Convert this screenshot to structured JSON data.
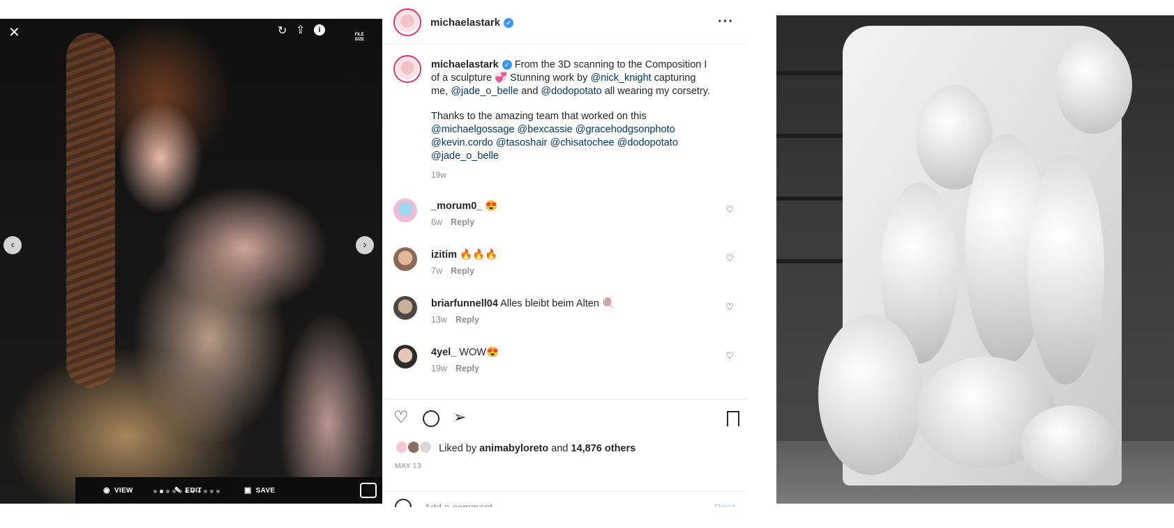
{
  "viewer": {
    "file_size_label": "FILE\nSIZE",
    "bottom_bar": {
      "view_label": "VIEW",
      "edit_label": "EDIT",
      "save_label": "SAVE"
    },
    "carousel_dots": 11,
    "active_dot": 1
  },
  "post": {
    "header_username": "michaelastark",
    "caption": {
      "username": "michaelastark",
      "line1": "From the 3D scanning to the Composition I",
      "line2_a": "of a sculpture ",
      "line2_emoji": "💞",
      "line2_b": " Stunning work by ",
      "mention_nick": "@nick_knight",
      "line2_c": " capturing",
      "line3_a": "me, ",
      "mention_jade": "@jade_o_belle",
      "line3_b": " and ",
      "mention_dodo": "@dodopotato",
      "line3_c": " all wearing my corsetry.",
      "para2": "Thanks to the amazing team that worked on this",
      "team_line1": "@michaelgossage @bexcassie @gracehodgsonphoto",
      "team_line2": "@kevin.cordo @tasoshair @chisatochee @dodopotato",
      "team_line3": "@jade_o_belle",
      "time": "19w"
    },
    "comments": [
      {
        "username": "_morum0_",
        "text": "😍",
        "time": "6w",
        "reply": "Reply"
      },
      {
        "username": "izitim",
        "text": "🔥🔥🔥",
        "time": "7w",
        "reply": "Reply"
      },
      {
        "username": "briarfunnell04",
        "text": "Alles bleibt beim Alten 🍭",
        "time": "13w",
        "reply": "Reply"
      },
      {
        "username": "4yel_",
        "text": "WOW😍",
        "time": "19w",
        "reply": "Reply"
      }
    ],
    "likes": {
      "prefix": "Liked by",
      "user": "animabyloreto",
      "middle": "and",
      "others": "14,876 others"
    },
    "date": "MAY 13",
    "add_comment_placeholder": "Add a comment...",
    "post_button": "Post"
  },
  "colors": {
    "link": "#00376b",
    "verified": "#3897f0",
    "muted": "#8e8e8e"
  }
}
